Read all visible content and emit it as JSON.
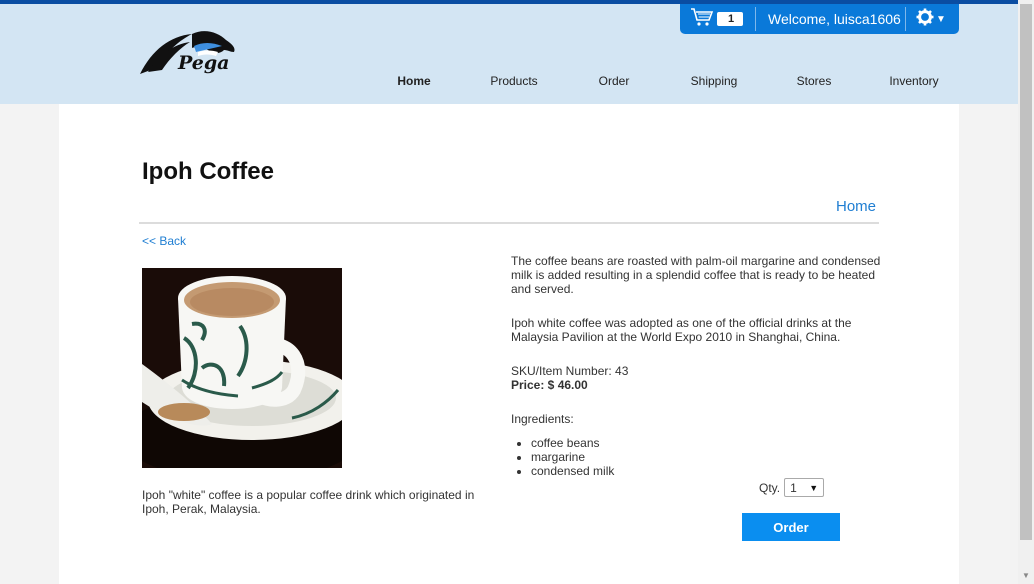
{
  "brand": {
    "name": "Pega"
  },
  "userbar": {
    "cart_count": "1",
    "welcome": "Welcome, luisca1606"
  },
  "nav": {
    "items": [
      "Home",
      "Products",
      "Order",
      "Shipping",
      "Stores",
      "Inventory"
    ],
    "active": "Home"
  },
  "page": {
    "title": "Ipoh Coffee",
    "breadcrumb": "Home",
    "back": "<< Back"
  },
  "product": {
    "image_caption": "Ipoh \"white\" coffee is a popular coffee drink which originated in Ipoh, Perak, Malaysia.",
    "description_1": "The coffee beans are roasted with palm-oil margarine and condensed milk is added resulting in a splendid coffee that is ready to be heated and served.",
    "description_2": "Ipoh white coffee was adopted as one of the official drinks at the Malaysia Pavilion at the World Expo 2010 in Shanghai, China.",
    "sku": "SKU/Item Number: 43",
    "price": "Price: $ 46.00",
    "ingredients_label": "Ingredients:",
    "ingredients": [
      "coffee beans",
      "margarine",
      "condensed milk"
    ]
  },
  "order": {
    "qty_label": "Qty.",
    "qty_value": "1",
    "button": "Order"
  },
  "colors": {
    "header_bg": "#d3e5f3",
    "accent": "#0a79d9",
    "link": "#1f7ed2",
    "button": "#0a8ef0"
  }
}
